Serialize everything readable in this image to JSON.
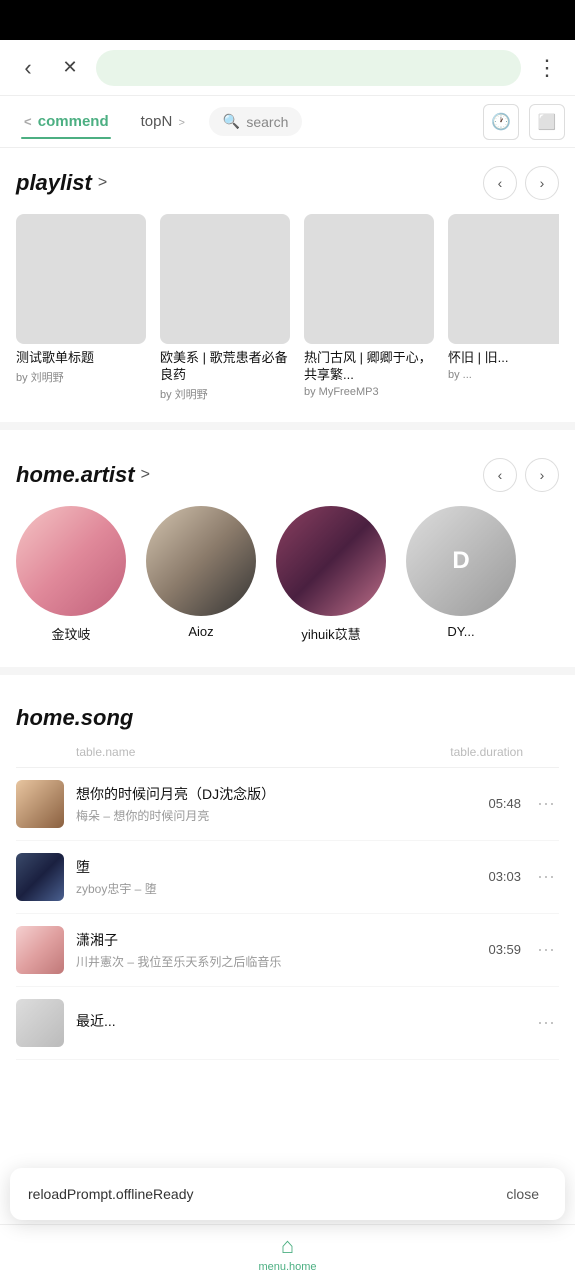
{
  "statusBar": {
    "background": "#000"
  },
  "browserToolbar": {
    "backLabel": "‹",
    "closeLabel": "✕",
    "moreLabel": "⋮"
  },
  "tabNav": {
    "tabs": [
      {
        "id": "commend",
        "label": "commend",
        "active": true,
        "hasChevron": false
      },
      {
        "id": "topN",
        "label": "topN",
        "active": false,
        "hasChevron": true
      }
    ],
    "searchPlaceholder": "search",
    "iconHistory": "🕐",
    "iconScreen": "⬜"
  },
  "playlist": {
    "title": "playlist",
    "arrowLabel": ">",
    "prevArrow": "‹",
    "nextArrow": "›",
    "cards": [
      {
        "id": 1,
        "title": "测试歌单标题",
        "by": "by 刘明野",
        "imgClass": "img-dog"
      },
      {
        "id": 2,
        "title": "欧美系 | 歌荒患者必备良药",
        "by": "by 刘明野",
        "imgClass": "img-purple"
      },
      {
        "id": 3,
        "title": "热门古风 | 卿卿于心，共享繁...",
        "by": "by MyFreeMP3",
        "imgClass": "img-lady"
      },
      {
        "id": 4,
        "title": "怀旧 | 旧...",
        "by": "by ...",
        "imgClass": "img-partial"
      }
    ]
  },
  "artist": {
    "title": "home.artist",
    "arrowLabel": ">",
    "prevArrow": "‹",
    "nextArrow": "›",
    "artists": [
      {
        "id": 1,
        "name": "金玟岐",
        "imgClass": "img-artist1"
      },
      {
        "id": 2,
        "name": "Aioz",
        "imgClass": "img-artist2"
      },
      {
        "id": 3,
        "name": "yihuik苡慧",
        "imgClass": "img-artist3"
      },
      {
        "id": 4,
        "name": "...",
        "imgClass": "img-artist4"
      }
    ]
  },
  "songs": {
    "title": "home.song",
    "tableNameCol": "table.name",
    "tableDurationCol": "table.duration",
    "items": [
      {
        "id": 1,
        "name": "想你的时候问月亮（DJ沈念版）",
        "artist": "梅朵 – 想你的时候问月亮",
        "duration": "05:48",
        "imgClass": "img-song1"
      },
      {
        "id": 2,
        "name": "堕",
        "artist": "zyboy忠宇 – 堕",
        "duration": "03:03",
        "imgClass": "img-song2"
      },
      {
        "id": 3,
        "name": "潇湘子",
        "artist": "川井憲次 – 我位至乐天系列之后临音乐",
        "duration": "03:59",
        "imgClass": "img-song3"
      },
      {
        "id": 4,
        "name": "最近...",
        "artist": "",
        "duration": "",
        "imgClass": "img-song4"
      }
    ]
  },
  "toast": {
    "message": "reloadPrompt.offlineReady",
    "closeLabel": "close"
  },
  "bottomNav": {
    "icon": "⌂",
    "label": "menu.home"
  }
}
